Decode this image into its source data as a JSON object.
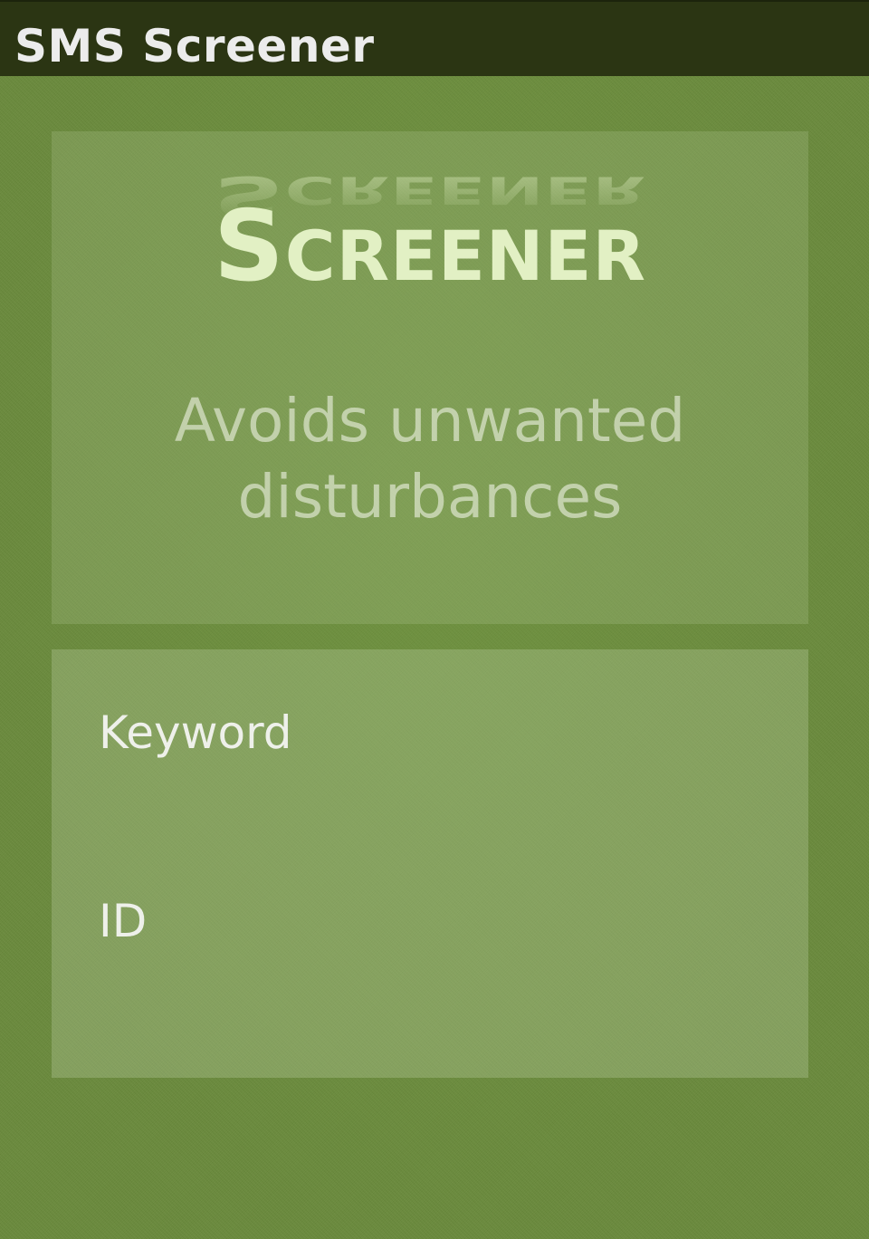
{
  "title_bar": {
    "title": "SMS Screener"
  },
  "hero": {
    "logo_text": "Screener",
    "tagline": "Avoids unwanted disturbances"
  },
  "form": {
    "keyword_label": "Keyword",
    "keyword_value": "",
    "id_label": "ID",
    "id_value": ""
  },
  "colors": {
    "background": "#6a8a3c",
    "title_bar": "#2b3513",
    "logo": "#e2f0c4",
    "label_text": "#eef0ea"
  }
}
